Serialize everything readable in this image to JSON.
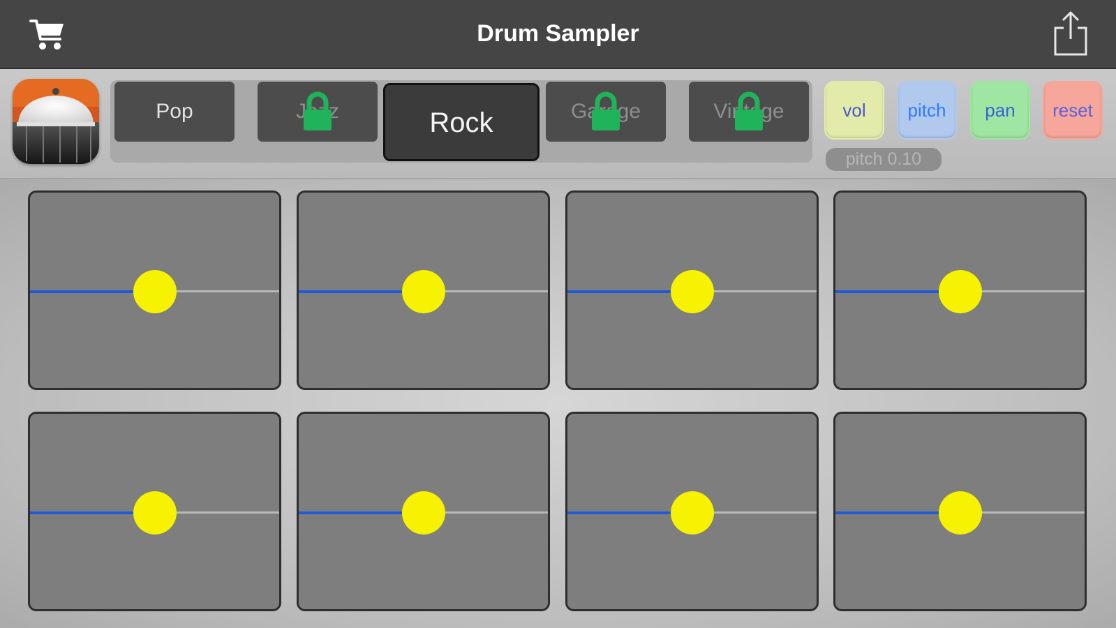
{
  "app": {
    "title": "Drum Sampler"
  },
  "icons": {
    "cart": "shopping-cart-icon",
    "share": "share-icon",
    "lock": "lock-icon"
  },
  "kits": [
    {
      "label": "Pop",
      "locked": false,
      "selected": false
    },
    {
      "label": "Jazz",
      "locked": true,
      "selected": false
    },
    {
      "label": "Rock",
      "locked": false,
      "selected": true
    },
    {
      "label": "Garage",
      "locked": true,
      "selected": false
    },
    {
      "label": "Vintage",
      "locked": true,
      "selected": false
    }
  ],
  "modes": [
    {
      "label": "vol",
      "bg": "#e3ebaa",
      "fg": "#4b57cc"
    },
    {
      "label": "pitch",
      "bg": "#b2c9ee",
      "fg": "#2e7bff"
    },
    {
      "label": "pan",
      "bg": "#9fe6a2",
      "fg": "#3a62d6"
    },
    {
      "label": "reset",
      "bg": "#f6a69a",
      "fg": "#5a63dc"
    }
  ],
  "param_display": "pitch 0.10",
  "colors": {
    "knob": "#f6f200",
    "track_fill": "#1f5bd8",
    "lock": "#1fb35a"
  },
  "pads": [
    {
      "slider": 0.5
    },
    {
      "slider": 0.5
    },
    {
      "slider": 0.5
    },
    {
      "slider": 0.5
    },
    {
      "slider": 0.5
    },
    {
      "slider": 0.5
    },
    {
      "slider": 0.5
    },
    {
      "slider": 0.5
    }
  ]
}
